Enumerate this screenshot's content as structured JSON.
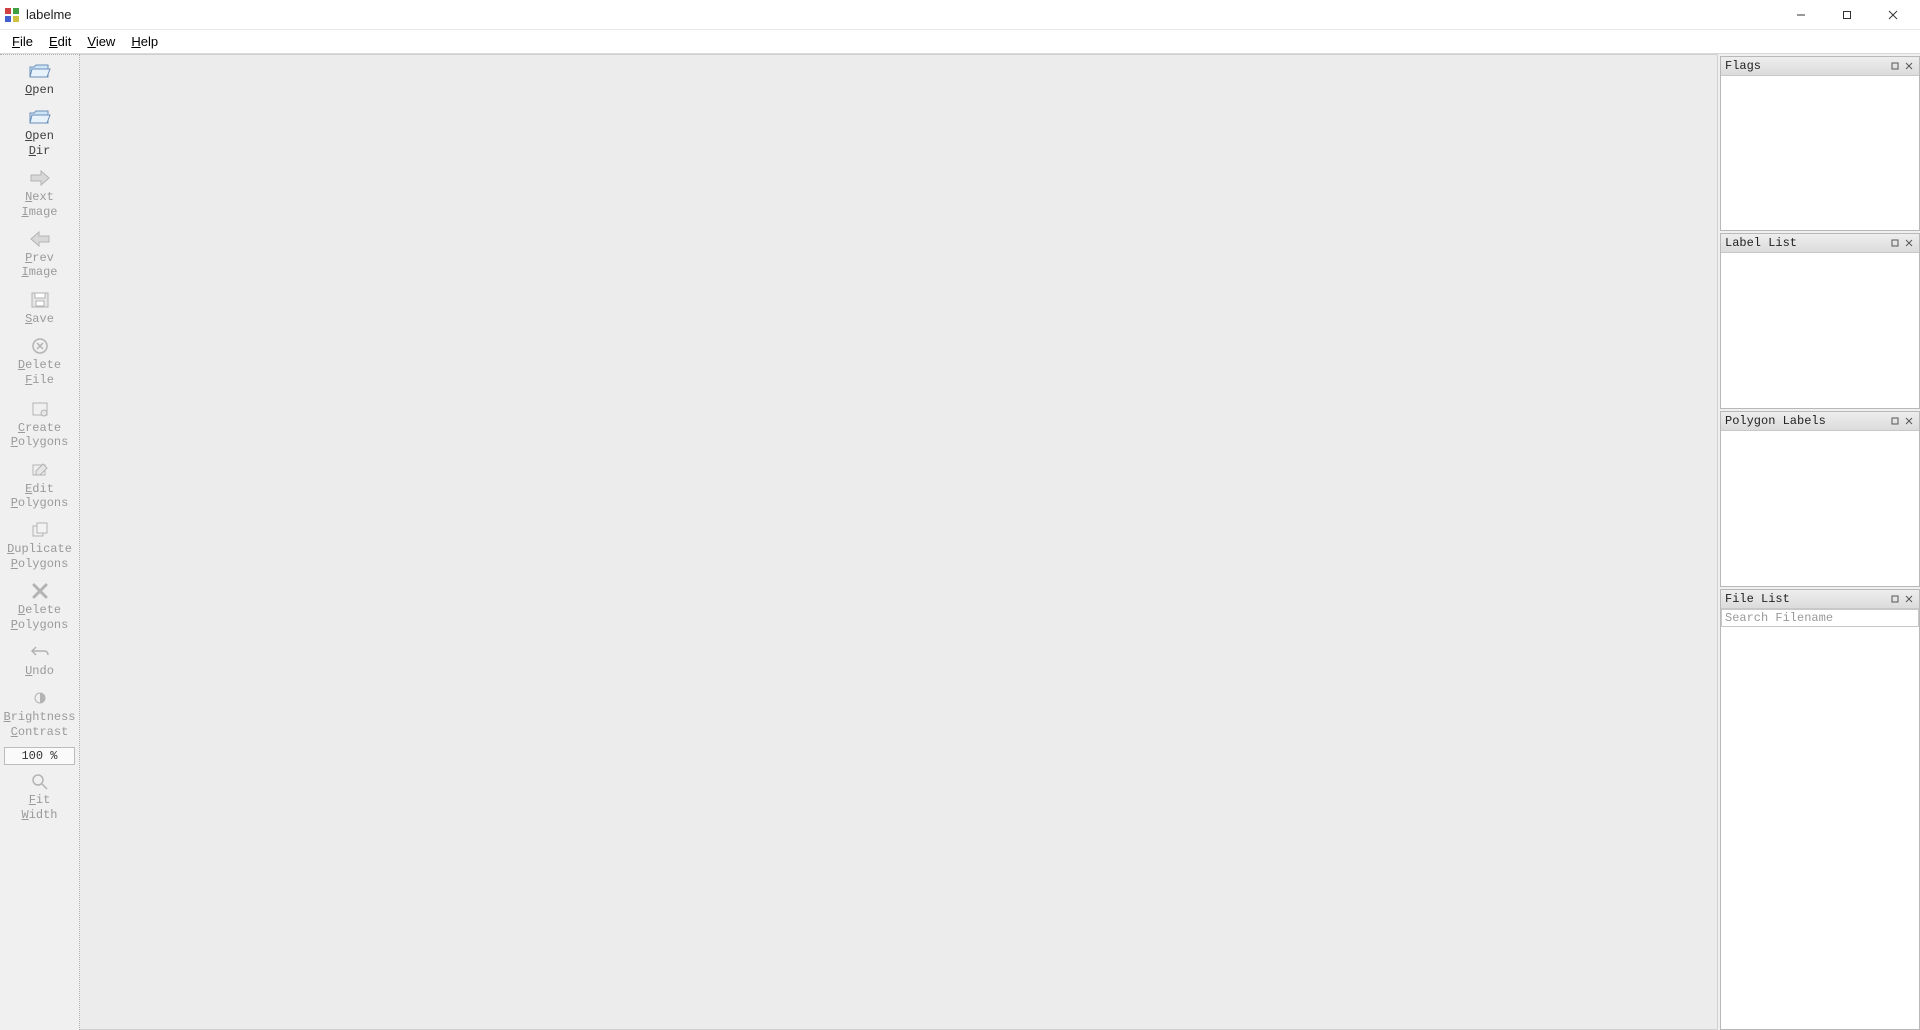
{
  "app": {
    "title": "labelme"
  },
  "menu": {
    "file": "File",
    "edit": "Edit",
    "view": "View",
    "help": "Help"
  },
  "toolbar": {
    "open": "Open",
    "open_dir": "Open\nDir",
    "next_image": "Next\nImage",
    "prev_image": "Prev\nImage",
    "save": "Save",
    "delete_file": "Delete\nFile",
    "create_polygons": "Create\nPolygons",
    "edit_polygons": "Edit\nPolygons",
    "duplicate_polygons": "Duplicate\nPolygons",
    "delete_polygons": "Delete\nPolygons",
    "undo": "Undo",
    "brightness_contrast": "Brightness\nContrast",
    "zoom": "100 %",
    "fit_width": "Fit\nWidth"
  },
  "panels": {
    "flags": "Flags",
    "label_list": "Label List",
    "polygon_labels": "Polygon Labels",
    "file_list": "File List",
    "search_placeholder": "Search Filename"
  }
}
